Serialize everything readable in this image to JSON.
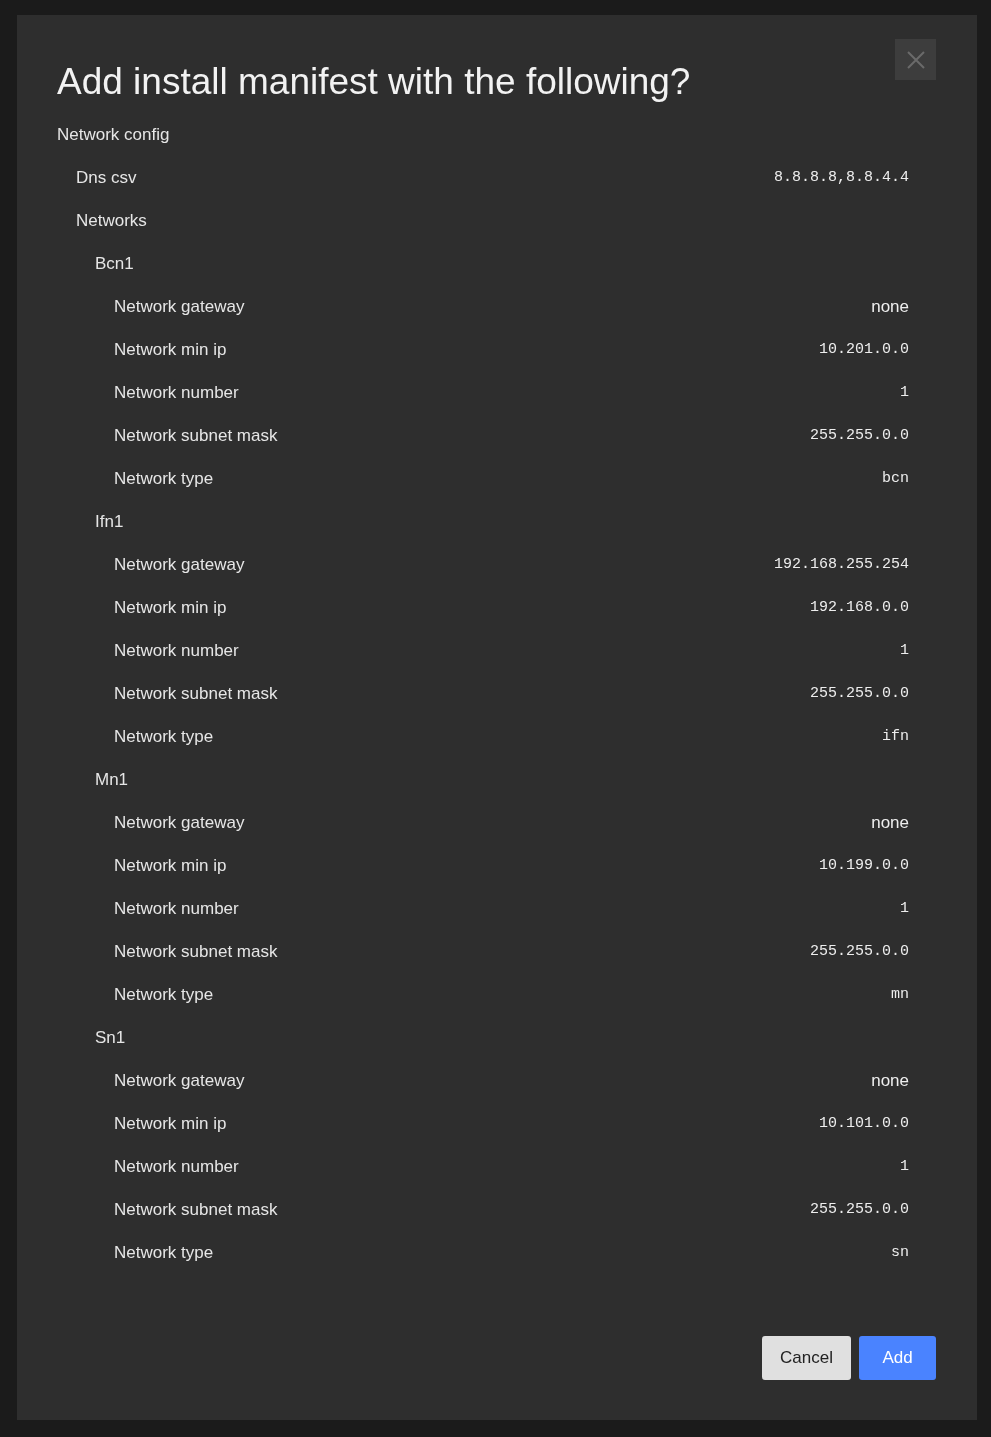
{
  "dialog": {
    "title": "Add install manifest with the following?",
    "entries": [
      {
        "label": "Network config",
        "children": [
          {
            "label": "Dns csv",
            "value": "8.8.8.8,8.8.4.4",
            "kind": "mono"
          },
          {
            "label": "Networks",
            "children": [
              {
                "label": "Bcn1",
                "children": [
                  {
                    "label": "Network gateway",
                    "value": "none",
                    "kind": "plain"
                  },
                  {
                    "label": "Network min ip",
                    "value": "10.201.0.0",
                    "kind": "mono"
                  },
                  {
                    "label": "Network number",
                    "value": "1",
                    "kind": "mono"
                  },
                  {
                    "label": "Network subnet mask",
                    "value": "255.255.0.0",
                    "kind": "mono"
                  },
                  {
                    "label": "Network type",
                    "value": "bcn",
                    "kind": "mono"
                  }
                ]
              },
              {
                "label": "Ifn1",
                "children": [
                  {
                    "label": "Network gateway",
                    "value": "192.168.255.254",
                    "kind": "mono"
                  },
                  {
                    "label": "Network min ip",
                    "value": "192.168.0.0",
                    "kind": "mono"
                  },
                  {
                    "label": "Network number",
                    "value": "1",
                    "kind": "mono"
                  },
                  {
                    "label": "Network subnet mask",
                    "value": "255.255.0.0",
                    "kind": "mono"
                  },
                  {
                    "label": "Network type",
                    "value": "ifn",
                    "kind": "mono"
                  }
                ]
              },
              {
                "label": "Mn1",
                "children": [
                  {
                    "label": "Network gateway",
                    "value": "none",
                    "kind": "plain"
                  },
                  {
                    "label": "Network min ip",
                    "value": "10.199.0.0",
                    "kind": "mono"
                  },
                  {
                    "label": "Network number",
                    "value": "1",
                    "kind": "mono"
                  },
                  {
                    "label": "Network subnet mask",
                    "value": "255.255.0.0",
                    "kind": "mono"
                  },
                  {
                    "label": "Network type",
                    "value": "mn",
                    "kind": "mono"
                  }
                ]
              },
              {
                "label": "Sn1",
                "children": [
                  {
                    "label": "Network gateway",
                    "value": "none",
                    "kind": "plain"
                  },
                  {
                    "label": "Network min ip",
                    "value": "10.101.0.0",
                    "kind": "mono"
                  },
                  {
                    "label": "Network number",
                    "value": "1",
                    "kind": "mono"
                  },
                  {
                    "label": "Network subnet mask",
                    "value": "255.255.0.0",
                    "kind": "mono"
                  },
                  {
                    "label": "Network type",
                    "value": "sn",
                    "kind": "mono"
                  }
                ]
              }
            ]
          }
        ]
      }
    ],
    "buttons": [
      {
        "label": "Cancel",
        "kind": "secondary"
      },
      {
        "label": "Add",
        "kind": "primary"
      }
    ]
  }
}
